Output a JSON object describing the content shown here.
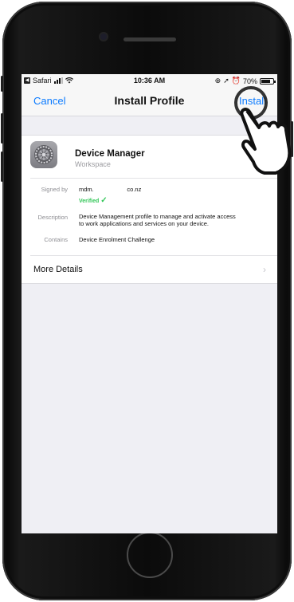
{
  "status_bar": {
    "back_app": "Safari",
    "time": "10:36 AM",
    "battery": "70%"
  },
  "nav": {
    "cancel": "Cancel",
    "title": "Install Profile",
    "install": "Install"
  },
  "profile": {
    "name": "Device Manager",
    "org": "Workspace",
    "signed_by_label": "Signed by",
    "signed_by_value": "mdm.                    co.nz",
    "verified": "Verified",
    "description_label": "Description",
    "description_line1": "Device Management profile to manage and activate access",
    "description_line2": "to work applications and services on your device.",
    "contains_label": "Contains",
    "contains_value": "Device Enrolment Challenge",
    "more_details": "More Details"
  },
  "icons": [
    "settings-gear-icon",
    "check-icon",
    "chevron-right-icon",
    "pointing-hand-icon"
  ]
}
